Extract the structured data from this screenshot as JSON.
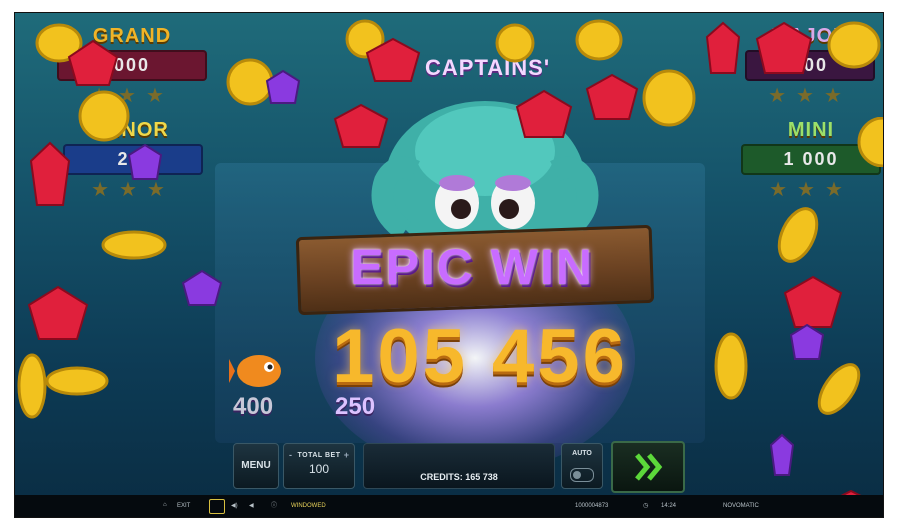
{
  "jackpots": {
    "grand": {
      "label": "GRAND",
      "value": "000",
      "stars": "★★★"
    },
    "minor": {
      "label": "MINOR",
      "value": "2 5",
      "stars": "★★★"
    },
    "major": {
      "label": "MAJOR",
      "value": "000",
      "stars": "★★★"
    },
    "mini": {
      "label": "MINI",
      "value": "1 000",
      "stars": "★★★"
    }
  },
  "game": {
    "logo": "CAPTAINS'"
  },
  "win": {
    "title": "EPIC WIN",
    "amount": "105 456"
  },
  "symbols": {
    "fish_value": "400",
    "shell_value": "250"
  },
  "controls": {
    "menu_label": "MENU",
    "total_bet_label": "TOTAL BET",
    "total_bet_value": "100",
    "bet_minus": "-",
    "bet_plus": "+",
    "credits_text": "CREDITS: 165 738",
    "auto_label": "AUTO"
  },
  "statusbar": {
    "exit_label": "EXIT",
    "windowed_label": "WINDOWED",
    "account_id": "1000004873",
    "time": "14:24",
    "brand": "NOVOMATIC"
  },
  "colors": {
    "coin": "#f2c21e",
    "ruby": "#e0203c",
    "amethyst": "#8a3ae0",
    "spin_arrow": "#5cd83a"
  }
}
